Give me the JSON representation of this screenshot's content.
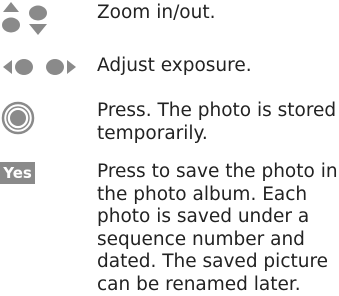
{
  "entries": [
    {
      "icon": "nav-up-down-icon",
      "lines": [
        "Zoom in/out."
      ]
    },
    {
      "icon": "nav-left-right-icon",
      "lines": [
        "Adjust exposure."
      ]
    },
    {
      "icon": "center-press-icon",
      "lines": [
        "Press. The photo is stored",
        "temporarily."
      ]
    },
    {
      "icon": "softkey",
      "softkey_label": "Yes",
      "lines": [
        "Press to save the photo in",
        "the photo album. Each",
        "photo is saved under a",
        "sequence number and",
        "dated. The saved picture",
        "can be renamed later."
      ]
    }
  ],
  "colors": {
    "text": "#222222",
    "icon_gray": "#8a8a8a",
    "softkey_bg": "#8a8a8a",
    "softkey_text": "#ffffff"
  }
}
